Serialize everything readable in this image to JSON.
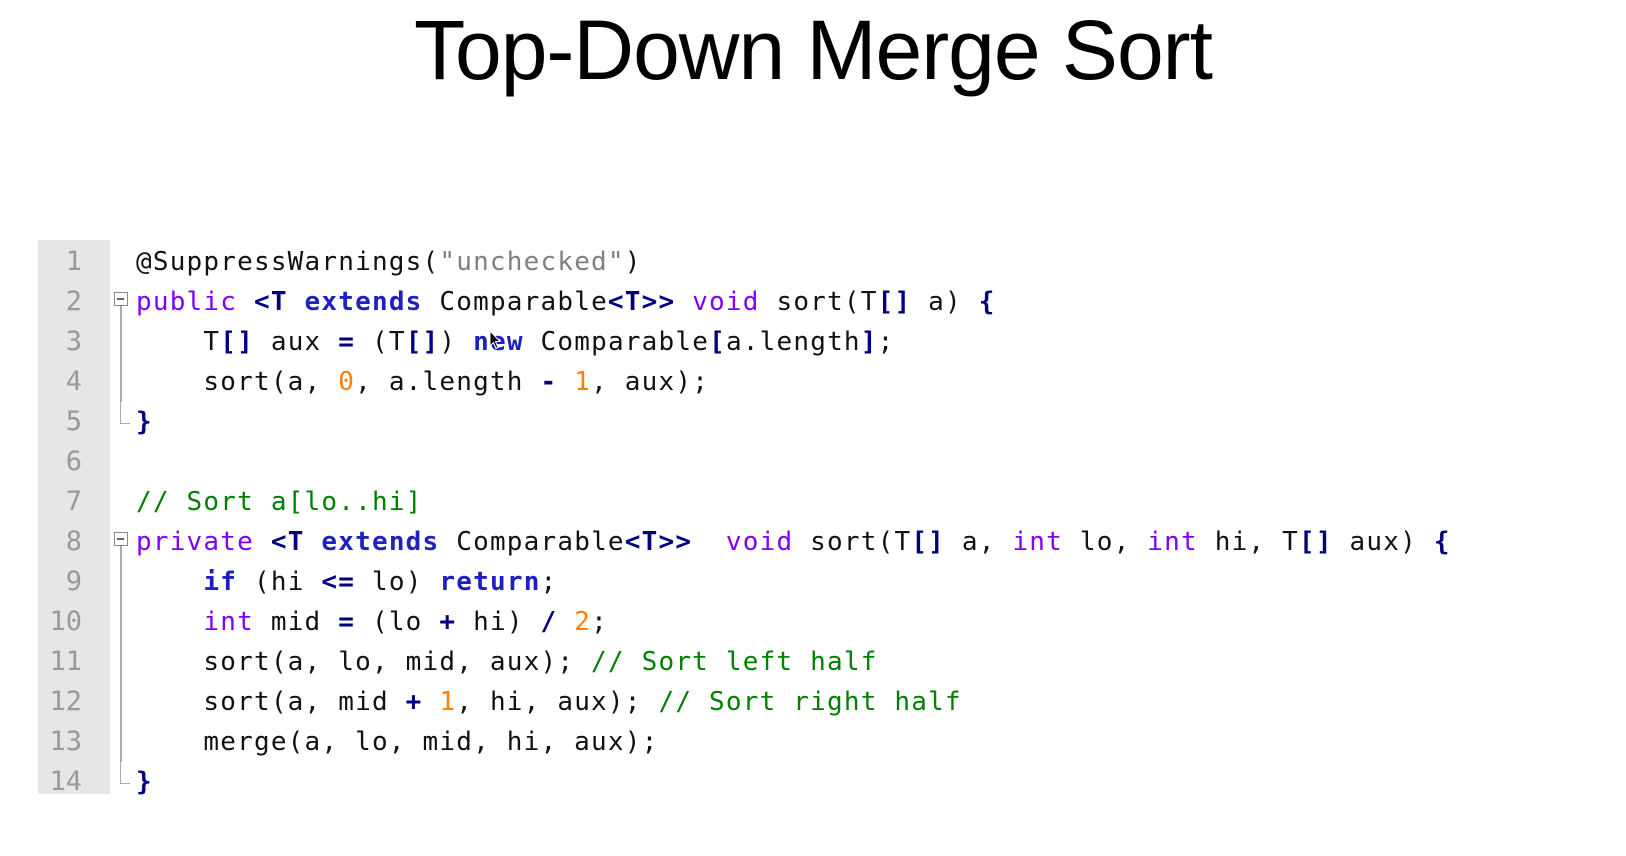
{
  "slide": {
    "title": "Top-Down Merge Sort"
  },
  "editor": {
    "lines": [
      {
        "number": "1",
        "fold": "none",
        "tokens": [
          {
            "t": "@SuppressWarnings(",
            "c": "plain"
          },
          {
            "t": "\"unchecked\"",
            "c": "string"
          },
          {
            "t": ")",
            "c": "plain"
          }
        ]
      },
      {
        "number": "2",
        "fold": "start",
        "tokens": [
          {
            "t": "public",
            "c": "keyword"
          },
          {
            "t": " <T ",
            "c": "punct"
          },
          {
            "t": "extends",
            "c": "bold-keyword"
          },
          {
            "t": " Comparable",
            "c": "plain"
          },
          {
            "t": "<T>>",
            "c": "punct"
          },
          {
            "t": " void",
            "c": "keyword"
          },
          {
            "t": " sort(T",
            "c": "plain"
          },
          {
            "t": "[]",
            "c": "punct"
          },
          {
            "t": " a) ",
            "c": "plain"
          },
          {
            "t": "{",
            "c": "brace"
          }
        ]
      },
      {
        "number": "3",
        "fold": "line",
        "tokens": [
          {
            "t": "    T",
            "c": "plain"
          },
          {
            "t": "[]",
            "c": "punct"
          },
          {
            "t": " aux ",
            "c": "plain"
          },
          {
            "t": "=",
            "c": "punct"
          },
          {
            "t": " (T",
            "c": "plain"
          },
          {
            "t": "[]",
            "c": "punct"
          },
          {
            "t": ") ",
            "c": "plain"
          },
          {
            "t": "new",
            "c": "bold-keyword"
          },
          {
            "t": " Comparable",
            "c": "plain"
          },
          {
            "t": "[",
            "c": "punct"
          },
          {
            "t": "a.length",
            "c": "plain"
          },
          {
            "t": "]",
            "c": "punct"
          },
          {
            "t": ";",
            "c": "plain"
          }
        ]
      },
      {
        "number": "4",
        "fold": "line",
        "tokens": [
          {
            "t": "    sort(a, ",
            "c": "plain"
          },
          {
            "t": "0",
            "c": "number"
          },
          {
            "t": ", a.length ",
            "c": "plain"
          },
          {
            "t": "-",
            "c": "punct"
          },
          {
            "t": " ",
            "c": "plain"
          },
          {
            "t": "1",
            "c": "number"
          },
          {
            "t": ", aux);",
            "c": "plain"
          }
        ]
      },
      {
        "number": "5",
        "fold": "end",
        "tokens": [
          {
            "t": "}",
            "c": "brace"
          }
        ]
      },
      {
        "number": "6",
        "fold": "none",
        "tokens": []
      },
      {
        "number": "7",
        "fold": "none",
        "tokens": [
          {
            "t": "// Sort a[lo..hi]",
            "c": "comment"
          }
        ]
      },
      {
        "number": "8",
        "fold": "start",
        "tokens": [
          {
            "t": "private",
            "c": "keyword"
          },
          {
            "t": " <T ",
            "c": "punct"
          },
          {
            "t": "extends",
            "c": "bold-keyword"
          },
          {
            "t": " Comparable",
            "c": "plain"
          },
          {
            "t": "<T>>",
            "c": "punct"
          },
          {
            "t": "  void",
            "c": "keyword"
          },
          {
            "t": " sort(T",
            "c": "plain"
          },
          {
            "t": "[]",
            "c": "punct"
          },
          {
            "t": " a, ",
            "c": "plain"
          },
          {
            "t": "int",
            "c": "keyword"
          },
          {
            "t": " lo, ",
            "c": "plain"
          },
          {
            "t": "int",
            "c": "keyword"
          },
          {
            "t": " hi, T",
            "c": "plain"
          },
          {
            "t": "[]",
            "c": "punct"
          },
          {
            "t": " aux) ",
            "c": "plain"
          },
          {
            "t": "{",
            "c": "brace"
          }
        ]
      },
      {
        "number": "9",
        "fold": "line",
        "tokens": [
          {
            "t": "    ",
            "c": "plain"
          },
          {
            "t": "if",
            "c": "bold-keyword"
          },
          {
            "t": " (hi ",
            "c": "plain"
          },
          {
            "t": "<=",
            "c": "punct"
          },
          {
            "t": " lo) ",
            "c": "plain"
          },
          {
            "t": "return",
            "c": "bold-keyword"
          },
          {
            "t": ";",
            "c": "plain"
          }
        ]
      },
      {
        "number": "10",
        "fold": "line",
        "tokens": [
          {
            "t": "    ",
            "c": "plain"
          },
          {
            "t": "int",
            "c": "keyword"
          },
          {
            "t": " mid ",
            "c": "plain"
          },
          {
            "t": "=",
            "c": "punct"
          },
          {
            "t": " (lo ",
            "c": "plain"
          },
          {
            "t": "+",
            "c": "punct"
          },
          {
            "t": " hi) ",
            "c": "plain"
          },
          {
            "t": "/",
            "c": "punct"
          },
          {
            "t": " ",
            "c": "plain"
          },
          {
            "t": "2",
            "c": "number"
          },
          {
            "t": ";",
            "c": "plain"
          }
        ]
      },
      {
        "number": "11",
        "fold": "line",
        "tokens": [
          {
            "t": "    sort(a, lo, mid, aux); ",
            "c": "plain"
          },
          {
            "t": "// Sort left half",
            "c": "comment"
          }
        ]
      },
      {
        "number": "12",
        "fold": "line",
        "tokens": [
          {
            "t": "    sort(a, mid ",
            "c": "plain"
          },
          {
            "t": "+",
            "c": "punct"
          },
          {
            "t": " ",
            "c": "plain"
          },
          {
            "t": "1",
            "c": "number"
          },
          {
            "t": ", hi, aux); ",
            "c": "plain"
          },
          {
            "t": "// Sort right half",
            "c": "comment"
          }
        ]
      },
      {
        "number": "13",
        "fold": "line",
        "tokens": [
          {
            "t": "    merge(a, lo, mid, hi, aux);",
            "c": "plain"
          }
        ]
      },
      {
        "number": "14",
        "fold": "end",
        "tokens": [
          {
            "t": "}",
            "c": "brace"
          }
        ]
      }
    ]
  }
}
